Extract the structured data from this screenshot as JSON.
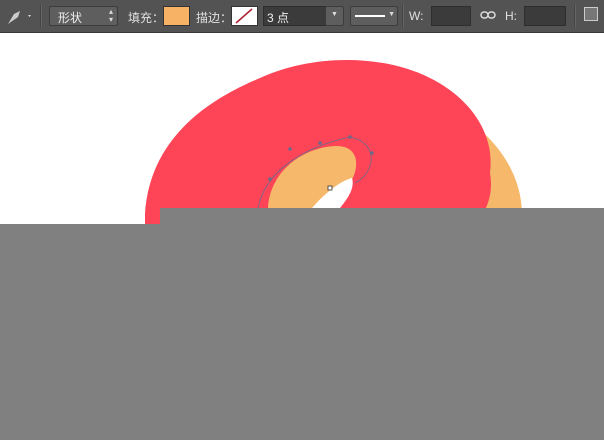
{
  "toolbar": {
    "tool_icon": "pen-tool-icon",
    "mode": "形状",
    "fill_label": "填充：",
    "fill_color": "#f7b266",
    "stroke_label": "描边：",
    "stroke_icon": "no-stroke-icon",
    "stroke_width": "3 点",
    "w_label": "W:",
    "w_value": "",
    "link_icon": "link-icon",
    "h_label": "H:",
    "h_value": ""
  },
  "canvas": {
    "donut_color": "#fe4558",
    "dough_color": "#f6b86a"
  }
}
